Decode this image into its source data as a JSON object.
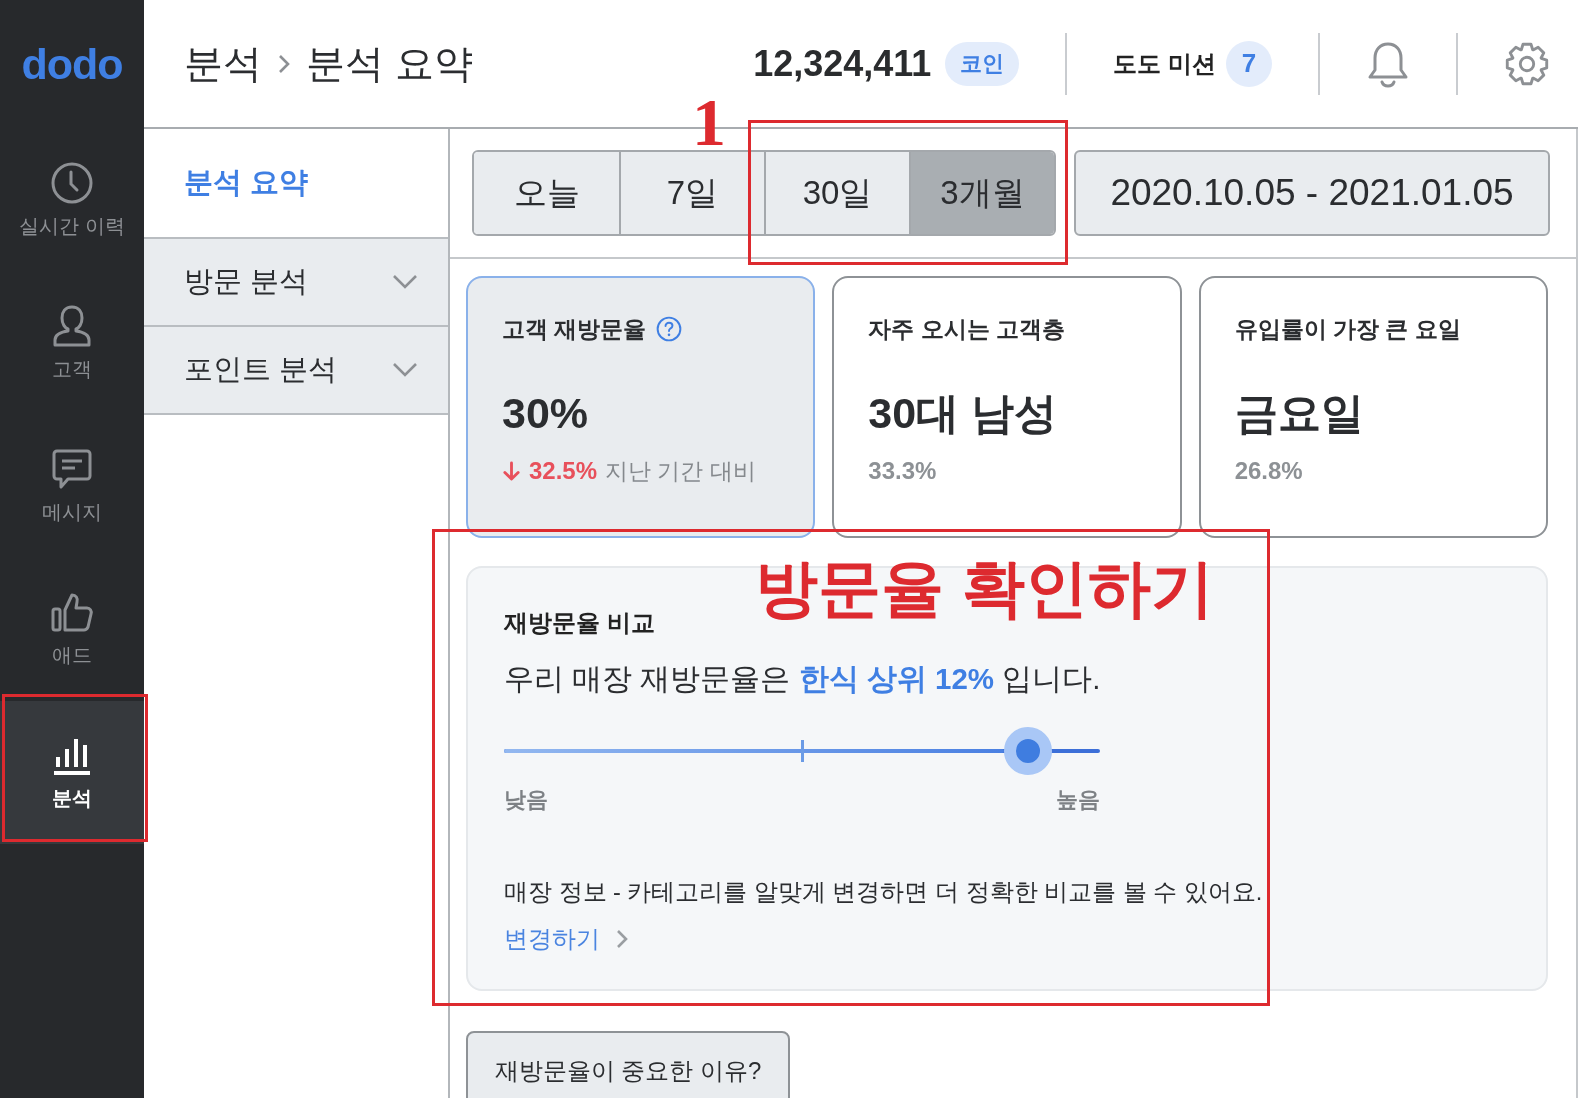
{
  "sidebar": {
    "logo": "dodo",
    "items": [
      {
        "label": "실시간 이력",
        "selected": false
      },
      {
        "label": "고객",
        "selected": false
      },
      {
        "label": "메시지",
        "selected": false
      },
      {
        "label": "애드",
        "selected": false
      },
      {
        "label": "분석",
        "selected": true
      }
    ]
  },
  "header": {
    "breadcrumb": [
      "분석",
      "분석 요약"
    ],
    "coins": {
      "amount": "12,324,411",
      "unit": "코인"
    },
    "mission": {
      "label": "도도 미션",
      "count": "7"
    }
  },
  "submenu": {
    "items": [
      {
        "label": "분석 요약",
        "kind": "page",
        "selected": true
      },
      {
        "label": "방문 분석",
        "kind": "group",
        "selected": false
      },
      {
        "label": "포인트 분석",
        "kind": "group",
        "selected": false
      }
    ]
  },
  "periods": [
    {
      "label": "오늘",
      "selected": false
    },
    {
      "label": "7일",
      "selected": false
    },
    {
      "label": "30일",
      "selected": false
    },
    {
      "label": "3개월",
      "selected": true
    }
  ],
  "date_range": "2020.10.05 - 2021.01.05",
  "cards": [
    {
      "title": "고객 재방문율",
      "help": true,
      "value": "30%",
      "selected": true,
      "change": {
        "down": true,
        "amount": "32.5%",
        "note": "지난 기간 대비"
      }
    },
    {
      "title": "자주 오시는 고객층",
      "help": false,
      "value": "30대 남성",
      "selected": false,
      "detail": "33.3%"
    },
    {
      "title": "유입률이 가장 큰 요일",
      "help": false,
      "value": "금요일",
      "selected": false,
      "detail": "26.8%"
    }
  ],
  "comparison": {
    "title": "재방문율 비교",
    "sentence": "우리 매장 재방문율은 **한식 상위 12%** 입니다.",
    "level": 0.88,
    "low_label": "낮음",
    "high_label": "높음",
    "note": "매장 정보 - 카테고리를 알맞게 변경하면 더 정확한 비교를 볼 수 있어요.",
    "link": "변경하기"
  },
  "help_button": "재방문율이 중요한 이유?",
  "annotations": [
    {
      "kind": "number",
      "text": "1"
    },
    {
      "kind": "frame"
    },
    {
      "kind": "frame"
    },
    {
      "kind": "frame"
    },
    {
      "kind": "caption",
      "text": "방문율 확인하기"
    }
  ]
}
